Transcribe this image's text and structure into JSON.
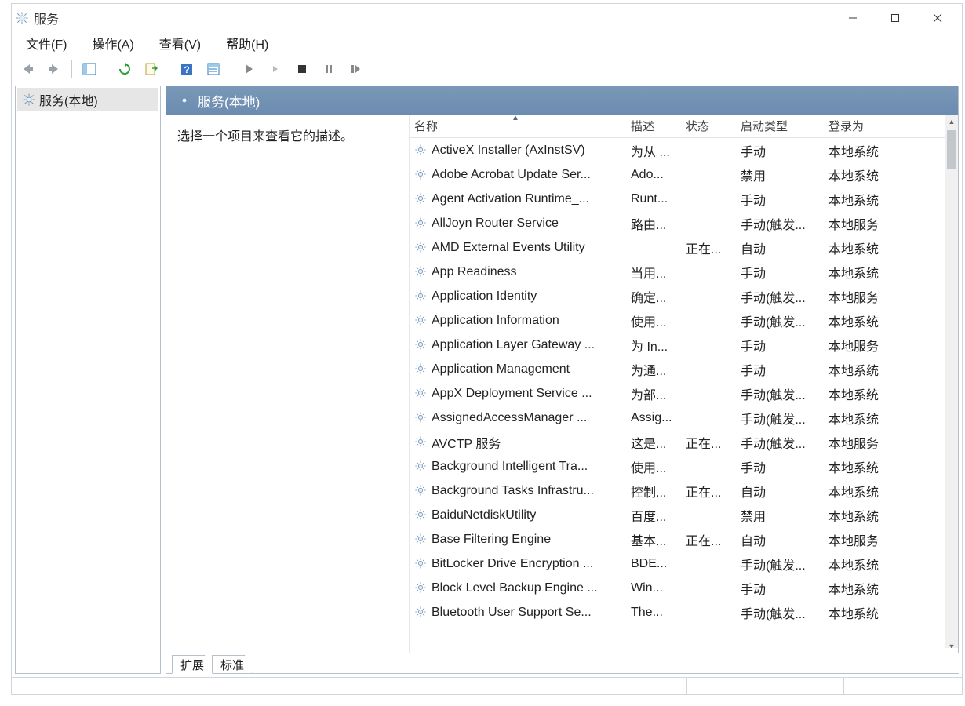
{
  "window": {
    "title": "服务"
  },
  "menu": {
    "file": "文件(F)",
    "action": "操作(A)",
    "view": "查看(V)",
    "help": "帮助(H)"
  },
  "tree": {
    "node": "服务(本地)"
  },
  "pane": {
    "header": "服务(本地)",
    "desc_prompt": "选择一个项目来查看它的描述。"
  },
  "columns": {
    "name": "名称",
    "desc": "描述",
    "status": "状态",
    "startup": "启动类型",
    "logon": "登录为"
  },
  "tabs": {
    "ext": "扩展",
    "std": "标准"
  },
  "services": [
    {
      "name": "ActiveX Installer (AxInstSV)",
      "desc": "为从 ...",
      "status": "",
      "startup": "手动",
      "logon": "本地系统"
    },
    {
      "name": "Adobe Acrobat Update Ser...",
      "desc": "Ado...",
      "status": "",
      "startup": "禁用",
      "logon": "本地系统"
    },
    {
      "name": "Agent Activation Runtime_...",
      "desc": "Runt...",
      "status": "",
      "startup": "手动",
      "logon": "本地系统"
    },
    {
      "name": "AllJoyn Router Service",
      "desc": "路由...",
      "status": "",
      "startup": "手动(触发...",
      "logon": "本地服务"
    },
    {
      "name": "AMD External Events Utility",
      "desc": "",
      "status": "正在...",
      "startup": "自动",
      "logon": "本地系统"
    },
    {
      "name": "App Readiness",
      "desc": "当用...",
      "status": "",
      "startup": "手动",
      "logon": "本地系统"
    },
    {
      "name": "Application Identity",
      "desc": "确定...",
      "status": "",
      "startup": "手动(触发...",
      "logon": "本地服务"
    },
    {
      "name": "Application Information",
      "desc": "使用...",
      "status": "",
      "startup": "手动(触发...",
      "logon": "本地系统"
    },
    {
      "name": "Application Layer Gateway ...",
      "desc": "为 In...",
      "status": "",
      "startup": "手动",
      "logon": "本地服务"
    },
    {
      "name": "Application Management",
      "desc": "为通...",
      "status": "",
      "startup": "手动",
      "logon": "本地系统"
    },
    {
      "name": "AppX Deployment Service ...",
      "desc": "为部...",
      "status": "",
      "startup": "手动(触发...",
      "logon": "本地系统"
    },
    {
      "name": "AssignedAccessManager ...",
      "desc": "Assig...",
      "status": "",
      "startup": "手动(触发...",
      "logon": "本地系统"
    },
    {
      "name": "AVCTP 服务",
      "desc": "这是...",
      "status": "正在...",
      "startup": "手动(触发...",
      "logon": "本地服务"
    },
    {
      "name": "Background Intelligent Tra...",
      "desc": "使用...",
      "status": "",
      "startup": "手动",
      "logon": "本地系统"
    },
    {
      "name": "Background Tasks Infrastru...",
      "desc": "控制...",
      "status": "正在...",
      "startup": "自动",
      "logon": "本地系统"
    },
    {
      "name": "BaiduNetdiskUtility",
      "desc": "百度...",
      "status": "",
      "startup": "禁用",
      "logon": "本地系统"
    },
    {
      "name": "Base Filtering Engine",
      "desc": "基本...",
      "status": "正在...",
      "startup": "自动",
      "logon": "本地服务"
    },
    {
      "name": "BitLocker Drive Encryption ...",
      "desc": "BDE...",
      "status": "",
      "startup": "手动(触发...",
      "logon": "本地系统"
    },
    {
      "name": "Block Level Backup Engine ...",
      "desc": "Win...",
      "status": "",
      "startup": "手动",
      "logon": "本地系统"
    },
    {
      "name": "Bluetooth User Support Se...",
      "desc": "The...",
      "status": "",
      "startup": "手动(触发...",
      "logon": "本地系统"
    }
  ],
  "statusbar": {
    "segs": [
      "",
      "",
      ""
    ]
  }
}
